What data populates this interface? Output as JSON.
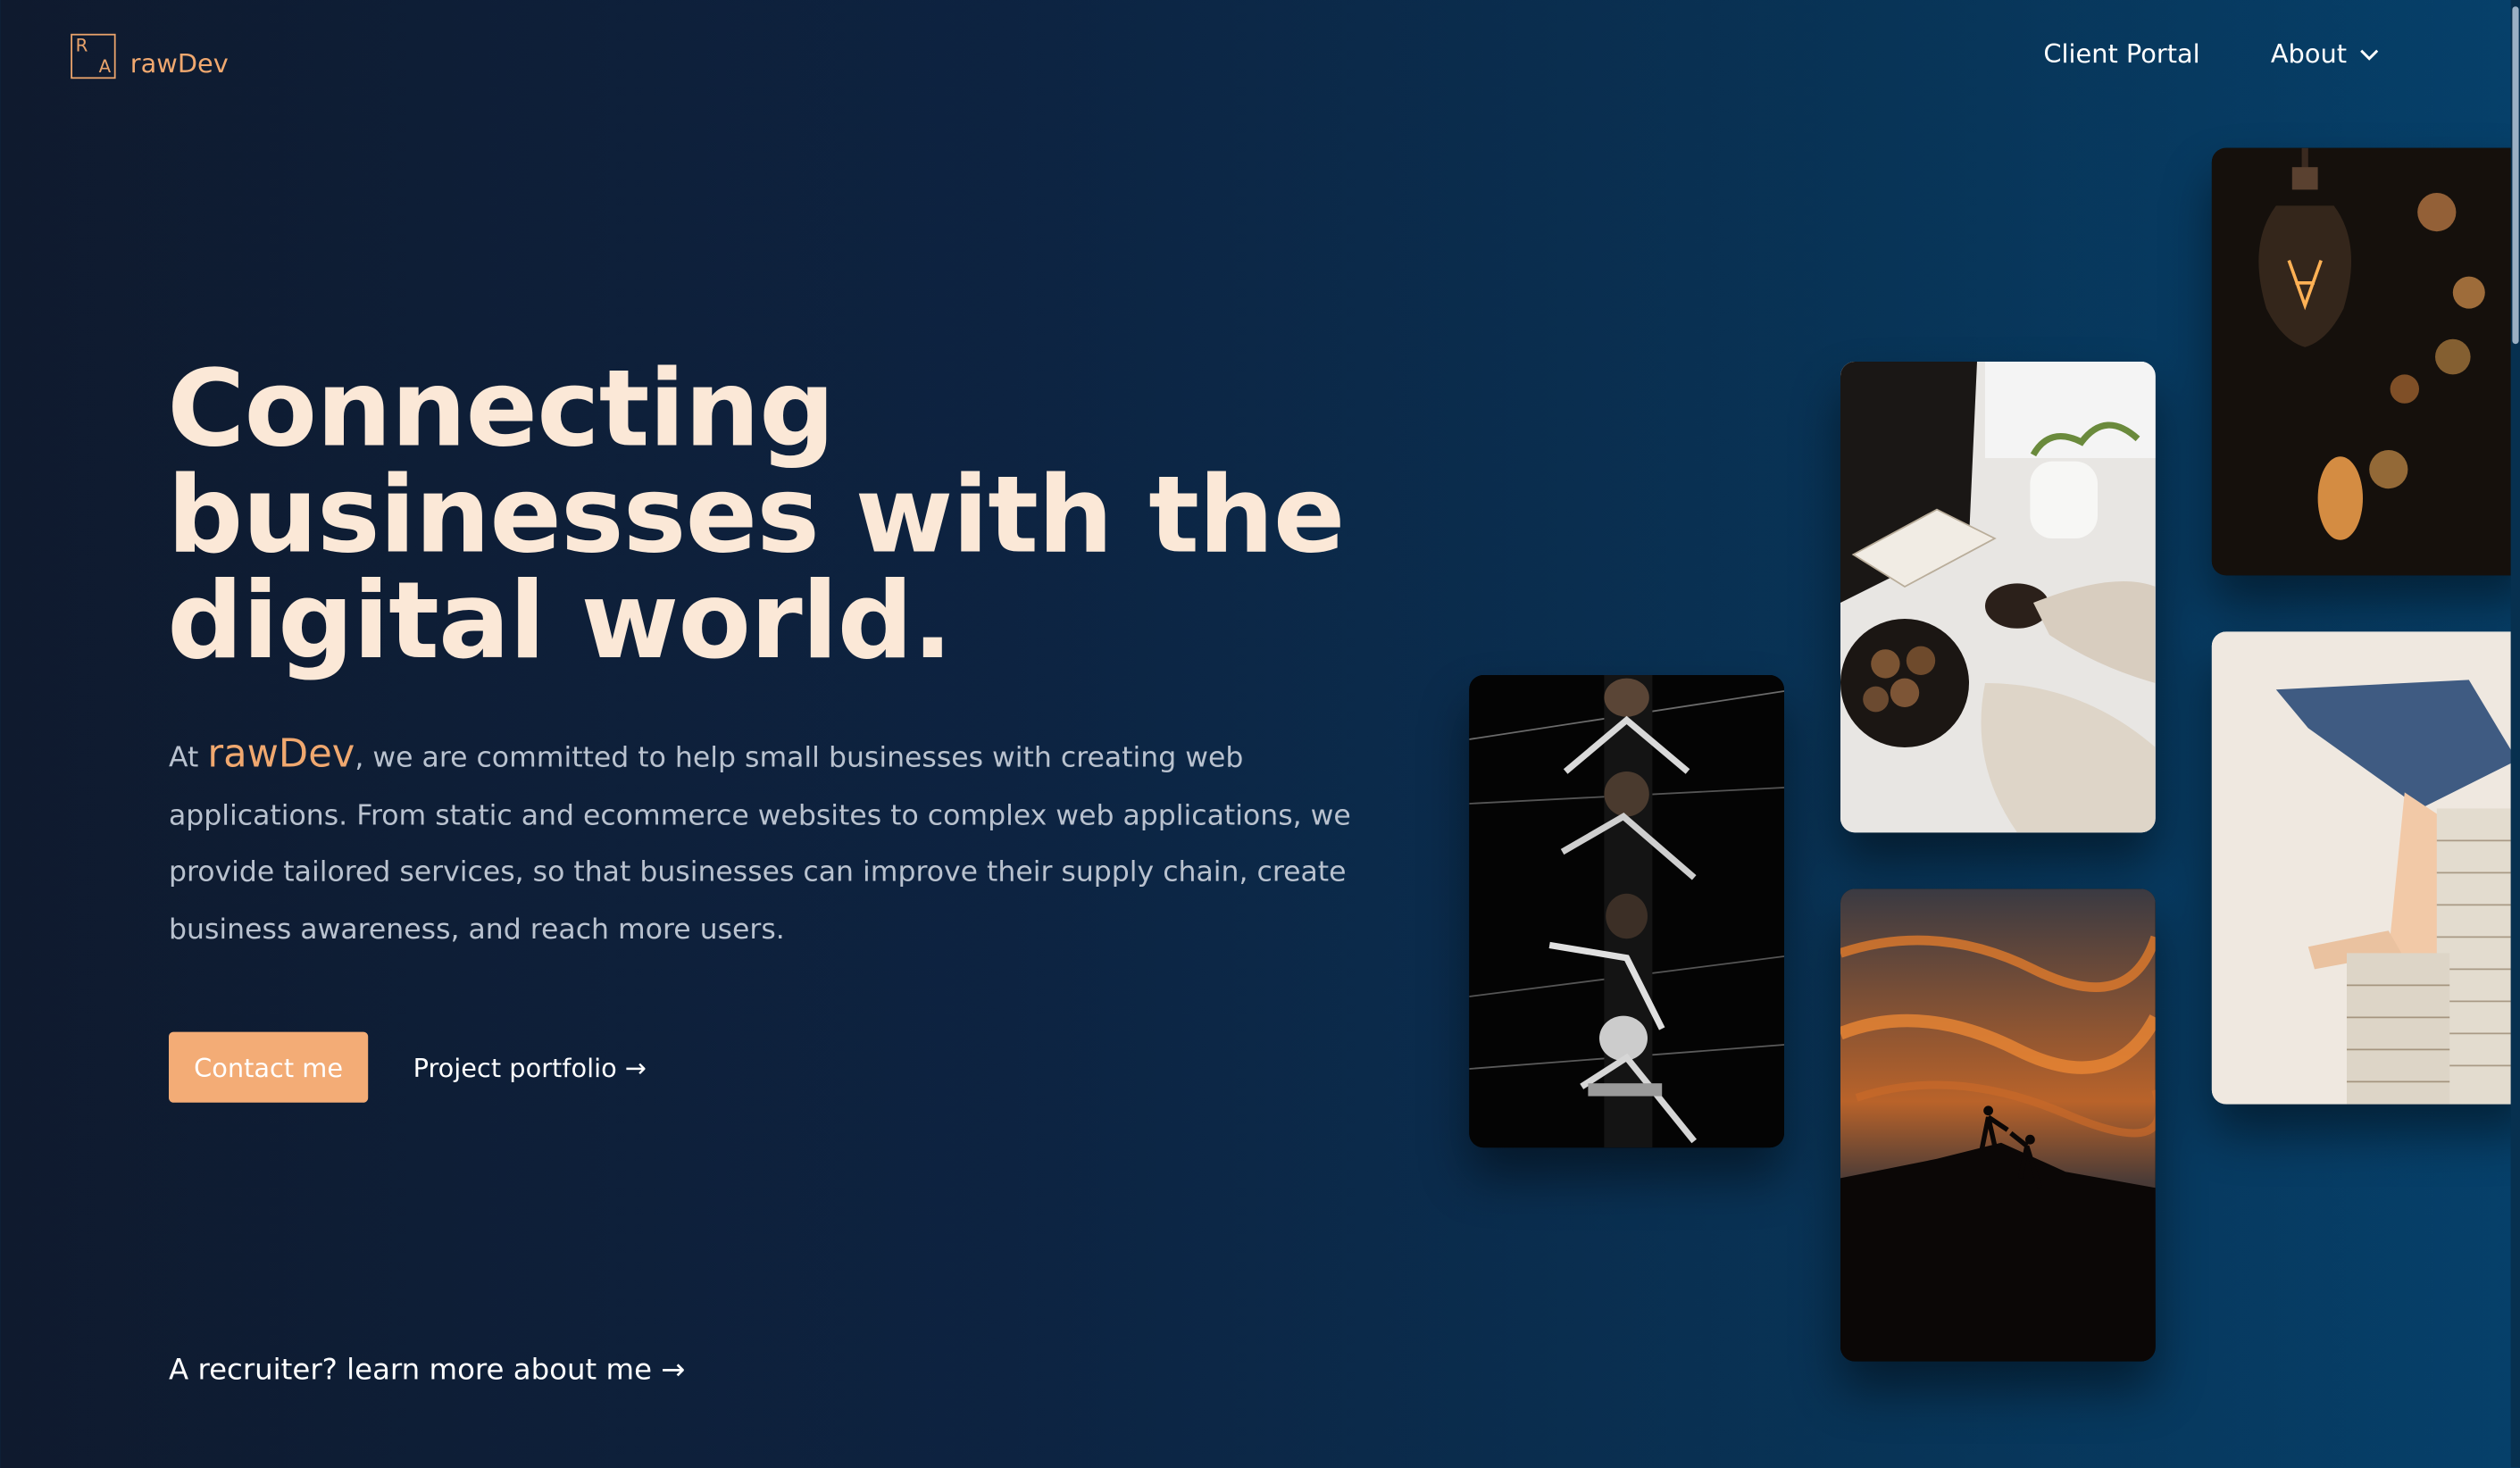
{
  "header": {
    "logo_letter_top": "R",
    "logo_letter_bottom": "A",
    "logo_text": "rawDev",
    "nav": {
      "client_portal": "Client Portal",
      "about": "About"
    }
  },
  "hero": {
    "headline_lines": [
      "Connecting",
      "businesses with the",
      "digital world."
    ],
    "lead_prefix": "At ",
    "lead_brand": "rawDev",
    "lead_rest": ", we are committed to help small businesses with creating web applications. From static and ecommerce websites to complex web applications, we provide tailored services, so that businesses can improve their supply chain, create business awareness, and reach more users.",
    "contact_label": "Contact me",
    "portfolio_label": "Project portfolio →",
    "recruiter_label": "A recruiter? learn more about me →"
  },
  "colors": {
    "accent": "#f3ac76",
    "headline": "#fbe8d7",
    "background_start": "#0f1a2e",
    "background_end": "#06406a"
  },
  "images": [
    {
      "name": "rowing-team-photo"
    },
    {
      "name": "coffee-table-photo"
    },
    {
      "name": "sunset-climbers-photo"
    },
    {
      "name": "light-bulbs-photo"
    },
    {
      "name": "books-stack-photo"
    }
  ]
}
